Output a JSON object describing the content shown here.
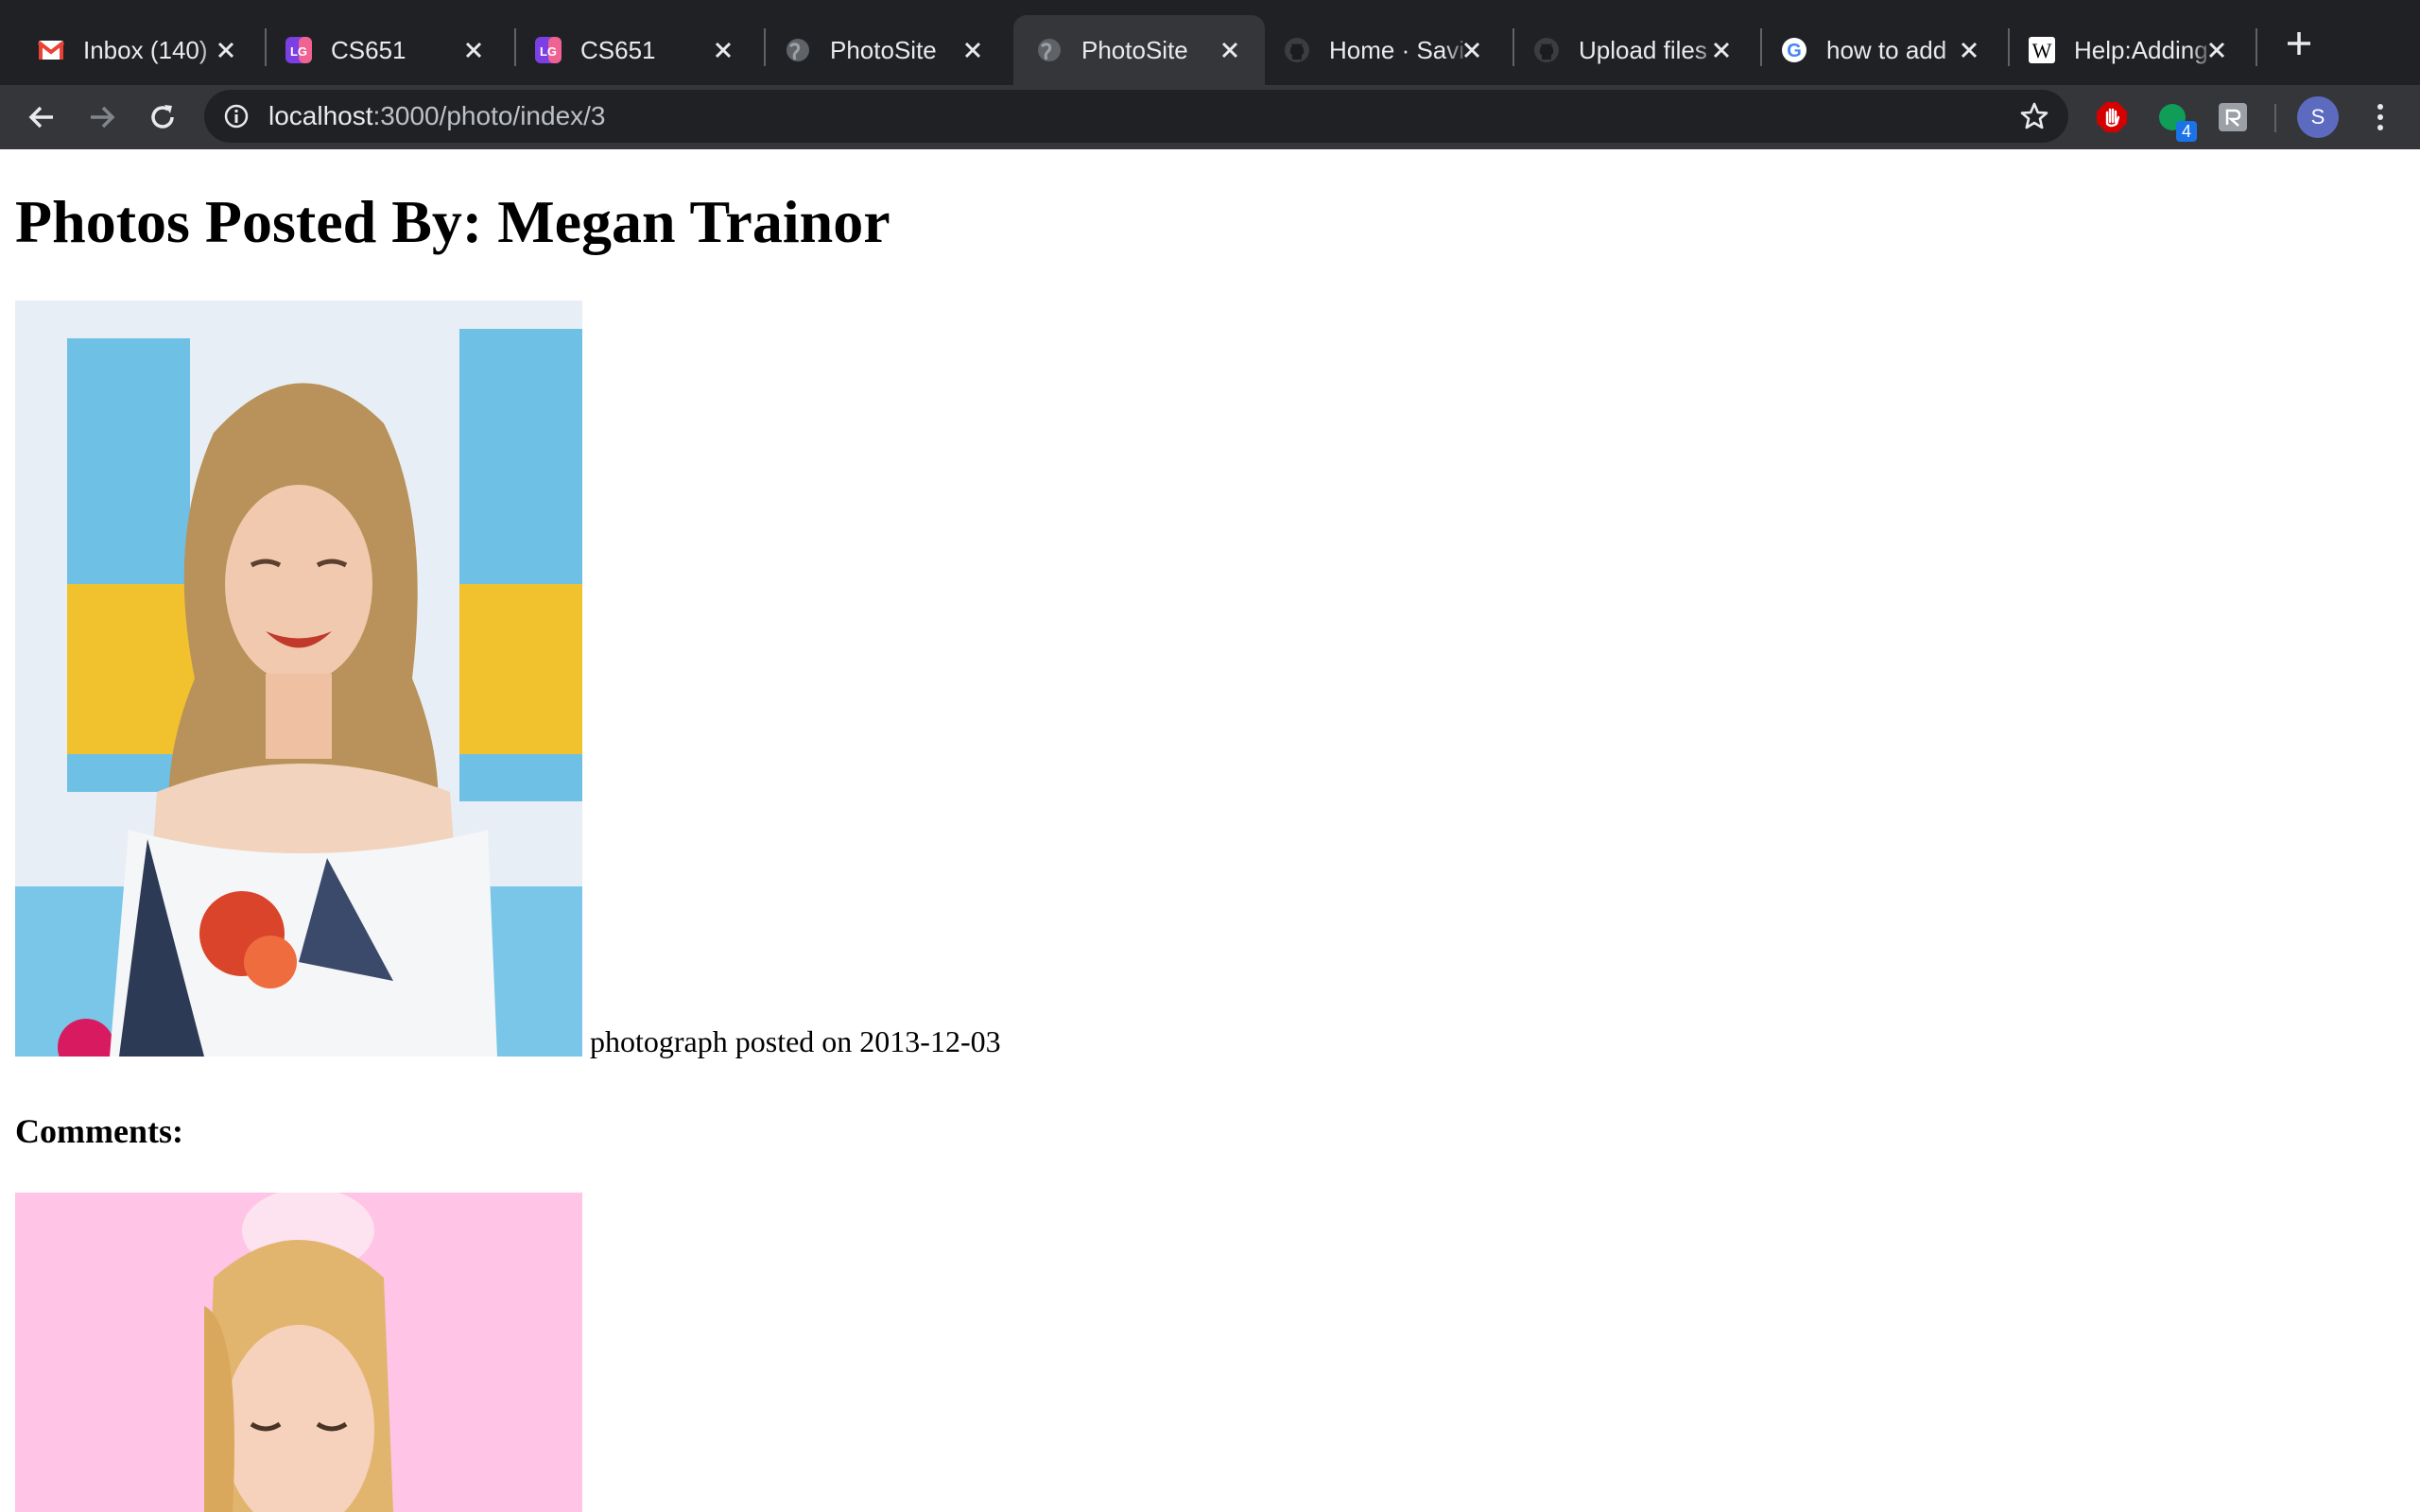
{
  "browser": {
    "tabs": [
      {
        "title": "Inbox (140)",
        "icon": "gmail-icon",
        "active": false
      },
      {
        "title": "CS651",
        "icon": "lg-icon",
        "active": false
      },
      {
        "title": "CS651",
        "icon": "lg-icon",
        "active": false
      },
      {
        "title": "PhotoSite",
        "icon": "globe-icon",
        "active": false
      },
      {
        "title": "PhotoSite",
        "icon": "globe-icon",
        "active": true
      },
      {
        "title": "Home · Savi",
        "icon": "github-icon",
        "active": false
      },
      {
        "title": "Upload files",
        "icon": "github-icon",
        "active": false
      },
      {
        "title": "how to add",
        "icon": "google-icon",
        "active": false
      },
      {
        "title": "Help:Adding",
        "icon": "wikipedia-icon",
        "active": false
      }
    ],
    "address": {
      "host": "localhost",
      "path": ":3000/photo/index/3"
    },
    "extension_badge": "4",
    "profile_initial": "S"
  },
  "page": {
    "heading": "Photos Posted By: Megan Trainor",
    "photos": [
      {
        "caption": "photograph posted on 2013-12-03"
      }
    ],
    "comments_heading": "Comments:"
  },
  "colors": {
    "tabbar_bg": "#202124",
    "toolbar_bg": "#35363a",
    "adblock_red": "#d50000",
    "ext_green": "#0f9d58",
    "avatar": "#5c6bc0"
  }
}
